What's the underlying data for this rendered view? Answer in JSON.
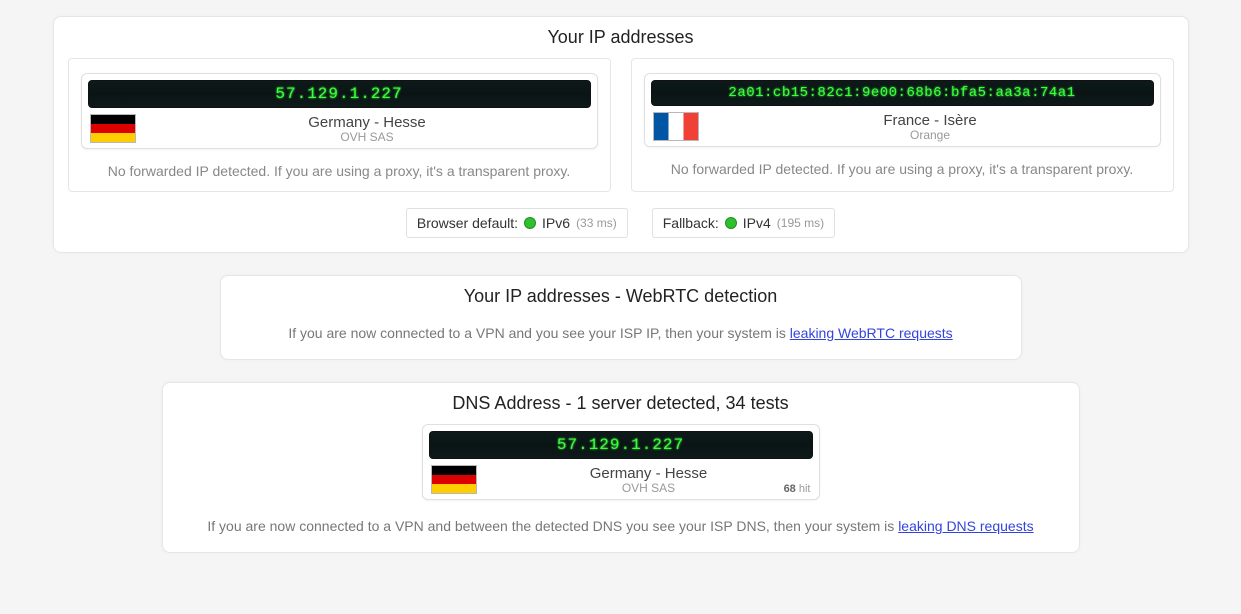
{
  "section1": {
    "title": "Your IP addresses",
    "ipv4": {
      "ip": "57.129.1.227",
      "location": "Germany - Hesse",
      "isp": "OVH SAS",
      "flag": "de",
      "note": "No forwarded IP detected. If you are using a proxy, it's a transparent proxy."
    },
    "ipv6": {
      "ip": "2a01:cb15:82c1:9e00:68b6:bfa5:aa3a:74a1",
      "location": "France - Isère",
      "isp": "Orange",
      "flag": "fr",
      "note": "No forwarded IP detected. If you are using a proxy, it's a transparent proxy."
    },
    "status": {
      "default_label": "Browser default:",
      "default_proto": "IPv6",
      "default_ms": "(33 ms)",
      "fallback_label": "Fallback:",
      "fallback_proto": "IPv4",
      "fallback_ms": "(195 ms)"
    }
  },
  "section2": {
    "title": "Your IP addresses - WebRTC detection",
    "text_before": "If you are now connected to a VPN and you see your ISP IP, then your system is ",
    "link": "leaking WebRTC requests"
  },
  "section3": {
    "title": "DNS Address - 1 server detected, 34 tests",
    "dns": {
      "ip": "57.129.1.227",
      "location": "Germany - Hesse",
      "isp": "OVH SAS",
      "flag": "de",
      "hit_count": "68",
      "hit_label": " hit"
    },
    "text_before": "If you are now connected to a VPN and between the detected DNS you see your ISP DNS, then your system is ",
    "link": "leaking DNS requests"
  }
}
